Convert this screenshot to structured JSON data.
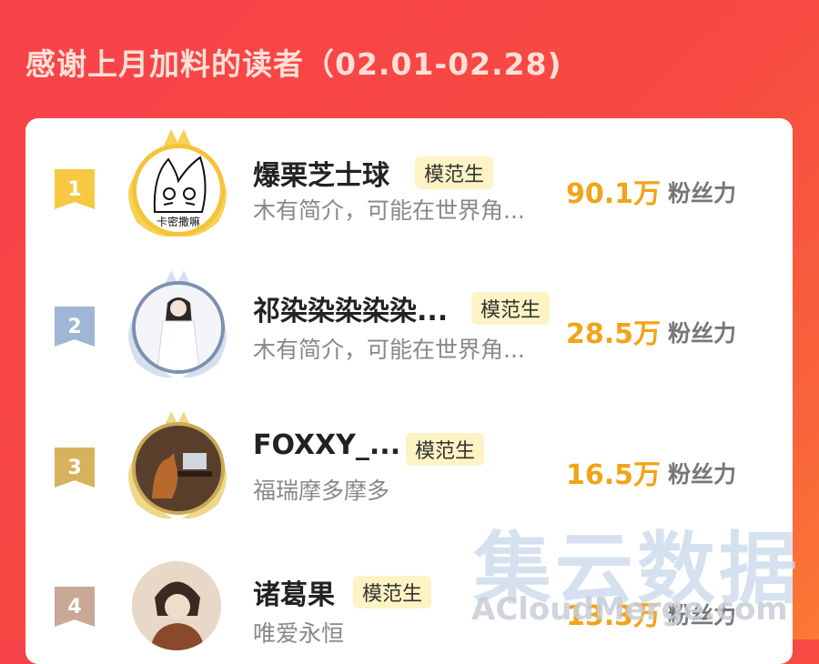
{
  "header": {
    "title": "感谢上月加料的读者（02.01-02.28)"
  },
  "colors": {
    "accent": "#f1a417",
    "tag_bg": "#fdf3c4",
    "rank_gold": "#f7c842",
    "rank_silver": "#9fb6d6",
    "rank_bronze": "#d6b25c",
    "rank_plain": "#c9a896"
  },
  "readers": [
    {
      "rank": "1",
      "name": "爆栗芝士球",
      "tag": "模范生",
      "bio": "木有简介，可能在世界角...",
      "fans_value": "90.1万",
      "fans_label": "粉丝力",
      "avatar_text": "卡密撒嘛"
    },
    {
      "rank": "2",
      "name": "祁染染染染染...",
      "tag": "模范生",
      "bio": "木有简介，可能在世界角...",
      "fans_value": "28.5万",
      "fans_label": "粉丝力"
    },
    {
      "rank": "3",
      "name": "FOXXY_...",
      "tag": "模范生",
      "bio": "福瑞摩多摩多",
      "fans_value": "16.5万",
      "fans_label": "粉丝力"
    },
    {
      "rank": "4",
      "name": "诸葛果",
      "tag": "模范生",
      "bio": "唯爱永恒",
      "fans_value": "13.3万",
      "fans_label": "粉丝力"
    }
  ],
  "watermark": {
    "cn": "集云数据",
    "en": "ACloudMerge.com"
  }
}
